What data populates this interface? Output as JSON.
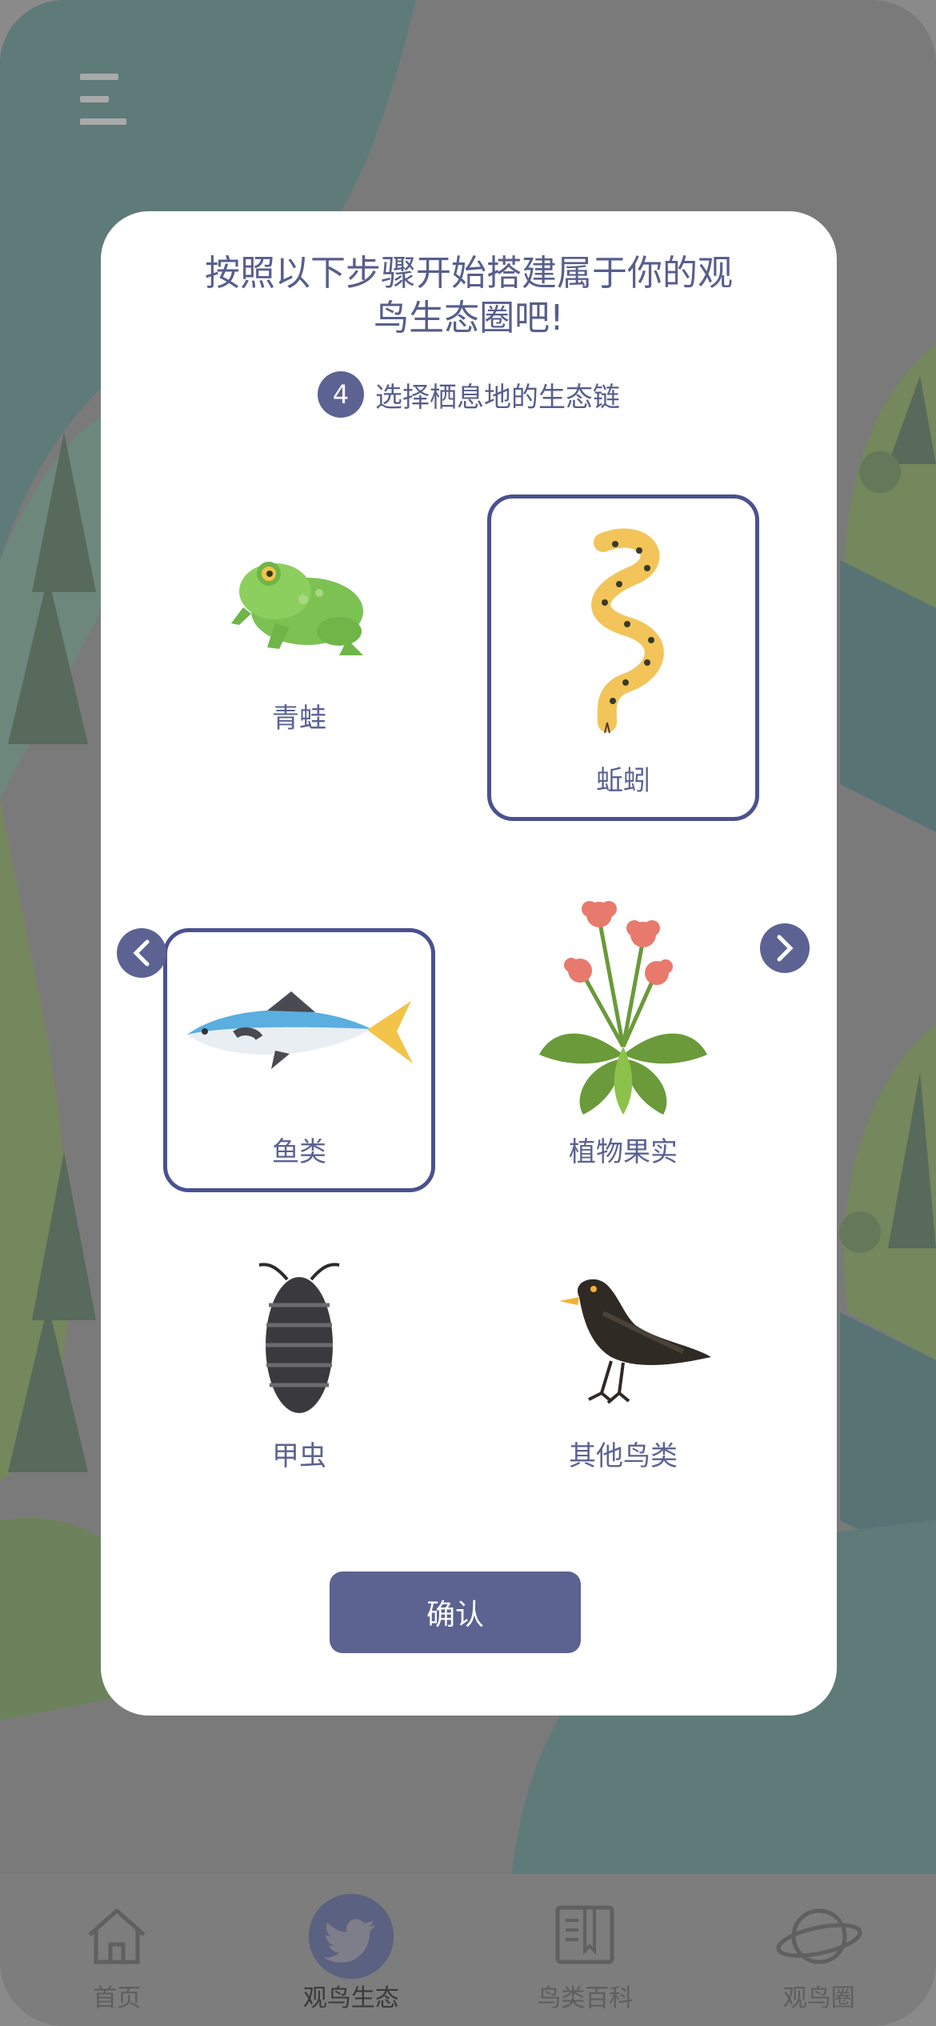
{
  "modal": {
    "title_line1": "按照以下步骤开始搭建属于你的观",
    "title_line2": "鸟生态圈吧!",
    "step_number": "4",
    "step_text": "选择栖息地的生态链",
    "confirm_label": "确认"
  },
  "options": [
    {
      "label": "青蛙",
      "icon": "frog-icon",
      "selected": false
    },
    {
      "label": "蚯蚓",
      "icon": "snake-icon",
      "selected": true
    },
    {
      "label": "鱼类",
      "icon": "fish-icon",
      "selected": true
    },
    {
      "label": "植物果实",
      "icon": "flower-plant-icon",
      "selected": false
    },
    {
      "label": "甲虫",
      "icon": "beetle-icon",
      "selected": false
    },
    {
      "label": "其他鸟类",
      "icon": "blackbird-icon",
      "selected": false
    }
  ],
  "tabbar": {
    "items": [
      {
        "label": "首页",
        "icon": "home-icon",
        "active": false
      },
      {
        "label": "观鸟生态",
        "icon": "twitter-bird-icon",
        "active": true
      },
      {
        "label": "鸟类百科",
        "icon": "book-icon",
        "active": false
      },
      {
        "label": "观鸟圈",
        "icon": "planet-icon",
        "active": false
      }
    ]
  },
  "colors": {
    "accent": "#5c6393",
    "selected_border": "#4a5190",
    "title": "#585e8c"
  }
}
